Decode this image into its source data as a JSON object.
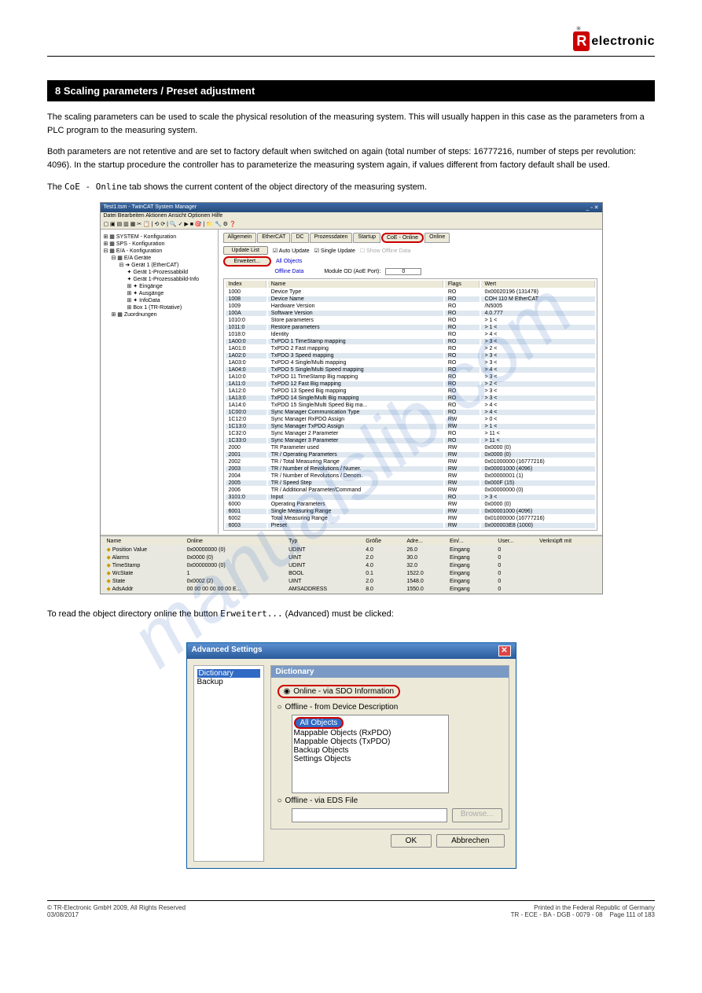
{
  "watermark": "manualslib.com",
  "logo_text": "electronic",
  "section_title": "8 Scaling parameters / Preset adjustment",
  "para1": "The scaling parameters can be used to scale the physical resolution of the measuring system. This will usually happen in this case as the parameters from a PLC program to the measuring system.",
  "para2": "Both parameters are not retentive and are set to factory default when switched on again (total number of steps: 16777216, number of steps per revolution: 4096). In the startup procedure the controller has to parameterize the measuring system again, if values different from factory default shall be used.",
  "para3_prefix": "The ",
  "para3_code": "CoE - Online",
  "para3_suffix": " tab shows the current content of the object directory of the measuring system.",
  "ss_title": "Test1.tsm - TwinCAT System Manager",
  "ss_menu": "Datei   Bearbeiten   Aktionen   Ansicht   Optionen   Hilfe",
  "tree": {
    "t0": "SYSTEM - Konfiguration",
    "t1": "SPS - Konfiguration",
    "t2": "E/A - Konfiguration",
    "t3": "E/A Geräte",
    "t4": "Gerät 1 (EtherCAT)",
    "t5": "Gerät 1-Prozessabbild",
    "t6": "Gerät 1-Prozessabbild-Info",
    "t7": "Eingänge",
    "t8": "Ausgänge",
    "t9": "InfoData",
    "t10": "Box 1 (TR-Rotative)",
    "t11": "Zuordnungen"
  },
  "tabs": [
    "Allgemein",
    "EtherCAT",
    "DC",
    "Prozessdaten",
    "Startup",
    "CoE - Online",
    "Online"
  ],
  "btn_update": "Update List",
  "btn_erw": "Erweitert...",
  "chk_auto": "Auto Update",
  "chk_single": "Single Update",
  "chk_show": "Show Offline Data",
  "link_all": "All Objects",
  "link_off": "Offline Data",
  "mod_label": "Module OD (AoE Port):",
  "mod_val": "0",
  "cols": [
    "Index",
    "Name",
    "Flags",
    "Wert"
  ],
  "rows": [
    [
      "1000",
      "Device Type",
      "RO",
      "0x00020196 (131478)"
    ],
    [
      "1008",
      "Device Name",
      "RO",
      "COH 110 M EtherCAT"
    ],
    [
      "1009",
      "Hardware Version",
      "RO",
      "/N5005"
    ],
    [
      "100A",
      "Software Version",
      "RO",
      "4.0.777"
    ],
    [
      "1010:0",
      "Store parameters",
      "RO",
      "> 1 <"
    ],
    [
      "1011:0",
      "Restore parameters",
      "RO",
      "> 1 <"
    ],
    [
      "1018:0",
      "Identity",
      "RO",
      "> 4 <"
    ],
    [
      "1A00:0",
      "TxPDO 1 TimeStamp mapping",
      "RO",
      "> 3 <"
    ],
    [
      "1A01:0",
      "TxPDO 2 Fast mapping",
      "RO",
      "> 2 <"
    ],
    [
      "1A02:0",
      "TxPDO 3 Speed mapping",
      "RO",
      "> 3 <"
    ],
    [
      "1A03:0",
      "TxPDO 4 Single/Multi mapping",
      "RO",
      "> 3 <"
    ],
    [
      "1A04:0",
      "TxPDO 5 Single/Multi Speed mapping",
      "RO",
      "> 4 <"
    ],
    [
      "1A10:0",
      "TxPDO 11 TimeStamp Big mapping",
      "RO",
      "> 3 <"
    ],
    [
      "1A11:0",
      "TxPDO 12 Fast Big mapping",
      "RO",
      "> 2 <"
    ],
    [
      "1A12:0",
      "TxPDO 13 Speed Big mapping",
      "RO",
      "> 3 <"
    ],
    [
      "1A13:0",
      "TxPDO 14 Single/Multi Big mapping",
      "RO",
      "> 3 <"
    ],
    [
      "1A14:0",
      "TxPDO 15 Single/Multi Speed Big ma...",
      "RO",
      "> 4 <"
    ],
    [
      "1C00:0",
      "Sync Manager Communication Type",
      "RO",
      "> 4 <"
    ],
    [
      "1C12:0",
      "Sync Manager RxPDO Assign",
      "RW",
      "> 0 <"
    ],
    [
      "1C13:0",
      "Sync Manager TxPDO Assign",
      "RW",
      "> 1 <"
    ],
    [
      "1C32:0",
      "Sync Manager 2 Parameter",
      "RO",
      "> 11 <"
    ],
    [
      "1C33:0",
      "Sync Manager 3 Parameter",
      "RO",
      "> 11 <"
    ],
    [
      "2000",
      "TR Parameter used",
      "RW",
      "0x0000 (0)"
    ],
    [
      "2001",
      "TR / Operating Parameters",
      "RW",
      "0x0000 (0)"
    ],
    [
      "2002",
      "TR / Total Measuring Range",
      "RW",
      "0x01000000 (16777216)"
    ],
    [
      "2003",
      "TR / Number of Revolutions / Numer.",
      "RW",
      "0x00001000 (4096)"
    ],
    [
      "2004",
      "TR / Number of Revolutions / Denom.",
      "RW",
      "0x00000001 (1)"
    ],
    [
      "2005",
      "TR / Speed Step",
      "RW",
      "0x000F (15)"
    ],
    [
      "2006",
      "TR / Additional Parameter/Command",
      "RW",
      "0x00000000 (0)"
    ],
    [
      "3101:0",
      "Input",
      "RO",
      "> 3 <"
    ],
    [
      "6000",
      "Operating Parameters",
      "RW",
      "0x0000 (0)"
    ],
    [
      "6001",
      "Single Measuring Range",
      "RW",
      "0x00001000 (4096)"
    ],
    [
      "6002",
      "Total Measuring Range",
      "RW",
      "0x01000000 (16777216)"
    ],
    [
      "6003",
      "Preset",
      "RW",
      "0x000003E8 (1000)"
    ]
  ],
  "bcols": [
    "Name",
    "Online",
    "Typ",
    "Größe",
    "Adre...",
    "Ein/...",
    "User...",
    "Verknüpft mit"
  ],
  "brows": [
    [
      "Position Value",
      "0x00000000 (0)",
      "UDINT",
      "4.0",
      "26.0",
      "Eingang",
      "0",
      ""
    ],
    [
      "Alarms",
      "0x0000 (0)",
      "UINT",
      "2.0",
      "30.0",
      "Eingang",
      "0",
      ""
    ],
    [
      "TimeStamp",
      "0x00000000 (0)",
      "UDINT",
      "4.0",
      "32.0",
      "Eingang",
      "0",
      ""
    ],
    [
      "WcState",
      "1",
      "BOOL",
      "0.1",
      "1522.0",
      "Eingang",
      "0",
      ""
    ],
    [
      "State",
      "0x0002 (2)",
      "UINT",
      "2.0",
      "1548.0",
      "Eingang",
      "0",
      ""
    ],
    [
      "AdsAddr",
      "00 00 00 00 00 00 E...",
      "AMSADDRESS",
      "8.0",
      "1550.0",
      "Eingang",
      "0",
      ""
    ]
  ],
  "caption_prefix": "To read the object directory online the button ",
  "caption_code": "Erweitert...",
  "caption_suffix": " (Advanced) must be clicked:",
  "dlg": {
    "title": "Advanced Settings",
    "tree1": "Dictionary",
    "tree2": "Backup",
    "group": "Dictionary",
    "r1": "Online - via SDO Information",
    "r2": "Offline - from Device Description",
    "l1": "All Objects",
    "l2": "Mappable Objects (RxPDO)",
    "l3": "Mappable Objects (TxPDO)",
    "l4": "Backup Objects",
    "l5": "Settings Objects",
    "r3": "Offline - via EDS File",
    "browse": "Browse...",
    "ok": "OK",
    "cancel": "Abbrechen"
  },
  "footer_left": "© TR-Electronic GmbH 2009, All Rights Reserved",
  "footer_right_1": "Printed in the Federal Republic of Germany",
  "footer_right_2": "TR - ECE - BA - DGB - 0079 - 08",
  "footer_date": "03/08/2017",
  "footer_page": "Page 111 of 183"
}
